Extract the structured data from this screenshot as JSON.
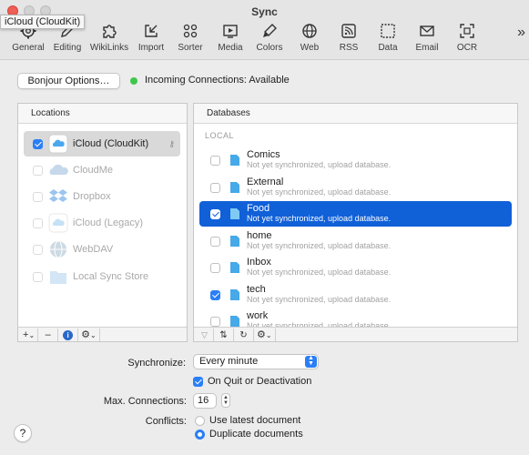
{
  "window": {
    "title": "Sync",
    "tooltip": "iCloud (CloudKit)"
  },
  "toolbar": {
    "items": [
      {
        "label": "General",
        "icon": "gear-icon"
      },
      {
        "label": "Editing",
        "icon": "pencil-icon"
      },
      {
        "label": "WikiLinks",
        "icon": "puzzle-icon"
      },
      {
        "label": "Import",
        "icon": "import-icon"
      },
      {
        "label": "Sorter",
        "icon": "sorter-icon"
      },
      {
        "label": "Media",
        "icon": "media-icon"
      },
      {
        "label": "Colors",
        "icon": "palette-icon"
      },
      {
        "label": "Web",
        "icon": "globe-icon"
      },
      {
        "label": "RSS",
        "icon": "rss-icon"
      },
      {
        "label": "Data",
        "icon": "data-icon"
      },
      {
        "label": "Email",
        "icon": "email-icon"
      },
      {
        "label": "OCR",
        "icon": "ocr-icon"
      }
    ],
    "more": "»"
  },
  "bonjour": {
    "button_label": "Bonjour Options…",
    "status_text": "Incoming Connections: Available",
    "status_color": "#3ec74a"
  },
  "locations": {
    "header": "Locations",
    "items": [
      {
        "label": "iCloud (CloudKit)",
        "checked": true,
        "enabled": true
      },
      {
        "label": "CloudMe",
        "checked": false,
        "enabled": false
      },
      {
        "label": "Dropbox",
        "checked": false,
        "enabled": false
      },
      {
        "label": "iCloud (Legacy)",
        "checked": false,
        "enabled": false
      },
      {
        "label": "WebDAV",
        "checked": false,
        "enabled": false
      },
      {
        "label": "Local Sync Store",
        "checked": false,
        "enabled": false
      }
    ],
    "footer": {
      "add": "+",
      "add_menu": "⌄",
      "remove": "–",
      "info": "i",
      "action": "⚙"
    }
  },
  "databases": {
    "header": "Databases",
    "section": "LOCAL",
    "items": [
      {
        "name": "Comics",
        "status": "Not yet synchronized, upload database.",
        "checked": false
      },
      {
        "name": "External",
        "status": "Not yet synchronized, upload database.",
        "checked": false
      },
      {
        "name": "Food",
        "status": "Not yet synchronized, upload database.",
        "checked": true
      },
      {
        "name": "home",
        "status": "Not yet synchronized, upload database.",
        "checked": false
      },
      {
        "name": "Inbox",
        "status": "Not yet synchronized, upload database.",
        "checked": false
      },
      {
        "name": "tech",
        "status": "Not yet synchronized, upload database.",
        "checked": true
      },
      {
        "name": "work",
        "status": "Not yet synchronized, upload database.",
        "checked": false
      }
    ]
  },
  "settings": {
    "synchronize_label": "Synchronize:",
    "synchronize_value": "Every minute",
    "quit_label": "On Quit or Deactivation",
    "quit_checked": true,
    "max_connections_label": "Max. Connections:",
    "max_connections_value": "16",
    "conflicts_label": "Conflicts:",
    "conflict_options": [
      {
        "label": "Use latest document",
        "selected": false
      },
      {
        "label": "Duplicate documents",
        "selected": true
      }
    ]
  },
  "help": "?"
}
